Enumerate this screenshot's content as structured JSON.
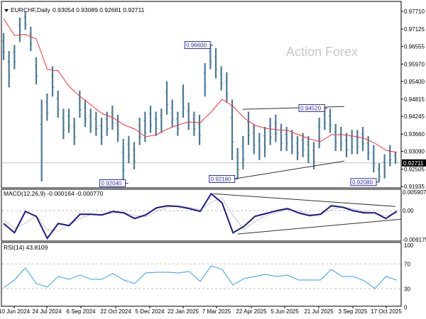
{
  "header": {
    "symbol": "EURCHF,Daily",
    "ohlc": "0.93054 0.93089 0.92681 0.92711"
  },
  "watermark": "Action Forex",
  "colors": {
    "bars": "#4a7a96",
    "ma": "#ff3030",
    "macd": "#1a1a8c",
    "signal": "#c8c8c8",
    "rsi": "#3399ff",
    "annotation": "#3030a0",
    "grid_dash": "#c0c0c0"
  },
  "chart_data": [
    {
      "type": "bar",
      "panel": "price",
      "yticks": [
        "0.97710",
        "0.97125",
        "0.96555",
        "0.95970",
        "0.95400",
        "0.94815",
        "0.94245",
        "0.93660",
        "0.93090",
        "0.92505",
        "0.91935"
      ],
      "ylim": [
        0.91935,
        0.9771
      ],
      "current_price": "0.92711",
      "xticks": [
        "10 Jun 2024",
        "24 Jul 2024",
        "6 Sep 2024",
        "22 Oct 2024",
        "5 Dec 2024",
        "22 Jan 2025",
        "7 Mar 2025",
        "22 Apr 2025",
        "5 Jun 2025",
        "21 Jul 2025",
        "3 Sep 2025",
        "17 Oct 2025"
      ],
      "bars_high_low": [
        [
          0.97,
          0.961
        ],
        [
          0.964,
          0.952
        ],
        [
          0.966,
          0.958
        ],
        [
          0.975,
          0.967
        ],
        [
          0.9771,
          0.971
        ],
        [
          0.972,
          0.964
        ],
        [
          0.962,
          0.953
        ],
        [
          0.948,
          0.921
        ],
        [
          0.95,
          0.941
        ],
        [
          0.959,
          0.949
        ],
        [
          0.951,
          0.942
        ],
        [
          0.945,
          0.935
        ],
        [
          0.945,
          0.937
        ],
        [
          0.942,
          0.933
        ],
        [
          0.951,
          0.942
        ],
        [
          0.948,
          0.939
        ],
        [
          0.945,
          0.937
        ],
        [
          0.944,
          0.936
        ],
        [
          0.942,
          0.933
        ],
        [
          0.944,
          0.936
        ],
        [
          0.946,
          0.938
        ],
        [
          0.943,
          0.934
        ],
        [
          0.935,
          0.9204
        ],
        [
          0.936,
          0.927
        ],
        [
          0.934,
          0.925
        ],
        [
          0.942,
          0.933
        ],
        [
          0.944,
          0.934
        ],
        [
          0.946,
          0.937
        ],
        [
          0.944,
          0.936
        ],
        [
          0.945,
          0.937
        ],
        [
          0.954,
          0.943
        ],
        [
          0.948,
          0.939
        ],
        [
          0.944,
          0.936
        ],
        [
          0.953,
          0.942
        ],
        [
          0.947,
          0.938
        ],
        [
          0.944,
          0.936
        ],
        [
          0.943,
          0.933
        ],
        [
          0.96,
          0.949
        ],
        [
          0.966,
          0.958
        ],
        [
          0.965,
          0.955
        ],
        [
          0.959,
          0.951
        ],
        [
          0.957,
          0.947
        ],
        [
          0.948,
          0.928
        ],
        [
          0.932,
          0.9218
        ],
        [
          0.936,
          0.925
        ],
        [
          0.944,
          0.933
        ],
        [
          0.94,
          0.93
        ],
        [
          0.937,
          0.928
        ],
        [
          0.939,
          0.929
        ],
        [
          0.942,
          0.933
        ],
        [
          0.943,
          0.934
        ],
        [
          0.94,
          0.931
        ],
        [
          0.939,
          0.931
        ],
        [
          0.938,
          0.93
        ],
        [
          0.936,
          0.928
        ],
        [
          0.937,
          0.929
        ],
        [
          0.936,
          0.927
        ],
        [
          0.934,
          0.925
        ],
        [
          0.942,
          0.932
        ],
        [
          0.9452,
          0.938
        ],
        [
          0.945,
          0.937
        ],
        [
          0.94,
          0.931
        ],
        [
          0.939,
          0.931
        ],
        [
          0.937,
          0.929
        ],
        [
          0.938,
          0.93
        ],
        [
          0.938,
          0.93
        ],
        [
          0.939,
          0.931
        ],
        [
          0.936,
          0.928
        ],
        [
          0.933,
          0.924
        ],
        [
          0.927,
          0.9208
        ],
        [
          0.93,
          0.922
        ],
        [
          0.933,
          0.926
        ],
        [
          0.93089,
          0.92681
        ]
      ],
      "moving_average": [
        0.97476,
        0.96915,
        0.9695,
        0.96798,
        0.95797,
        0.95746,
        0.95232,
        0.94904,
        0.94624,
        0.94343,
        0.94203,
        0.93969,
        0.93829,
        0.93572,
        0.93642,
        0.93829,
        0.93969,
        0.94063,
        0.94039,
        0.9439,
        0.94811,
        0.94577,
        0.94203,
        0.93946,
        0.93852,
        0.93805,
        0.93782,
        0.93642,
        0.93502,
        0.93408,
        0.93642,
        0.93642,
        0.93595,
        0.93525,
        0.93361,
        0.93127,
        0.93057
      ],
      "annotations": [
        {
          "text": "0.96600",
          "bar": 38.5,
          "price": 0.966,
          "side": "left"
        },
        {
          "text": "0.94520",
          "bar": 59.5,
          "price": 0.9452,
          "side": "left"
        },
        {
          "text": "0.92180",
          "bar": 43,
          "price": 0.9218,
          "side": "left"
        },
        {
          "text": "0.92040",
          "bar": 22.9,
          "price": 0.9204,
          "side": "left"
        },
        {
          "text": "0.92080",
          "bar": 69,
          "price": 0.9208,
          "side": "left"
        }
      ],
      "trendlines": [
        {
          "from": [
            43.9,
            0.9448
          ],
          "to": [
            62.6,
            0.9457
          ]
        },
        {
          "from": [
            42.2,
            0.9218
          ],
          "to": [
            62.6,
            0.9277
          ]
        }
      ]
    },
    {
      "type": "line",
      "panel": "macd",
      "label": "MACD(12,26,9) -0.000164 -0.000770",
      "yticks": [
        "0.005907",
        "0.00",
        "-0.009175"
      ],
      "ylim": [
        -0.009175,
        0.005907
      ],
      "macd": [
        -0.00405,
        -0.00698,
        -0.00023,
        -0.0018,
        -0.00878,
        -0.00405,
        -0.00473,
        -0.00113,
        -0.00113,
        -0.00135,
        -0.00023,
        -0.00068,
        -0.00248,
        -0.00135,
        0.0009,
        0.00158,
        0.00135,
        0.00068,
        -0.00023,
        0.0054,
        0.00248,
        -0.007,
        -0.005,
        -0.0018,
        -0.0009,
        0.0,
        0.00068,
        -0.00068,
        -0.00158,
        -0.00113,
        0.00158,
        0.00113,
        0.0,
        -0.00068,
        -0.00068,
        -0.00248,
        -0.000164
      ],
      "signal": [
        -0.003,
        -0.0055,
        -0.004,
        -0.0015,
        -0.006,
        -0.0065,
        -0.0045,
        -0.0025,
        -0.0012,
        -0.0012,
        -0.0008,
        -0.0005,
        -0.0015,
        -0.0019,
        -0.0003,
        0.0011,
        0.0015,
        0.0011,
        0.0003,
        0.0028,
        0.004,
        -0.0015,
        -0.006,
        -0.0035,
        -0.0015,
        -0.0005,
        0.0003,
        0.0,
        -0.0011,
        -0.0013,
        0.0003,
        0.0013,
        0.0006,
        -0.0003,
        -0.0007,
        -0.0017,
        -0.00077
      ],
      "trendlines": [
        {
          "from": [
            38.5,
            0.0054
          ],
          "to": [
            72,
            0.00135
          ]
        },
        {
          "from": [
            43,
            -0.0074
          ],
          "to": [
            73,
            -0.0027
          ]
        }
      ]
    },
    {
      "type": "line",
      "panel": "rsi",
      "label": "RSI(14) 43.8109",
      "yticks": [
        "100",
        "70",
        "30",
        "0"
      ],
      "ylim": [
        0,
        100
      ],
      "levels": [
        70,
        30
      ],
      "rsi": [
        31.4,
        44,
        63.4,
        38.3,
        32.6,
        49.7,
        45.1,
        52,
        45.1,
        45.1,
        54.3,
        44,
        38.3,
        55.4,
        56.6,
        56.6,
        55.4,
        57.7,
        41.7,
        66.9,
        61.1,
        36,
        46.3,
        49.7,
        53.1,
        49.7,
        52,
        44,
        44,
        44,
        61.1,
        49.7,
        49.7,
        42.9,
        30.3,
        49.7,
        43.81
      ]
    }
  ]
}
